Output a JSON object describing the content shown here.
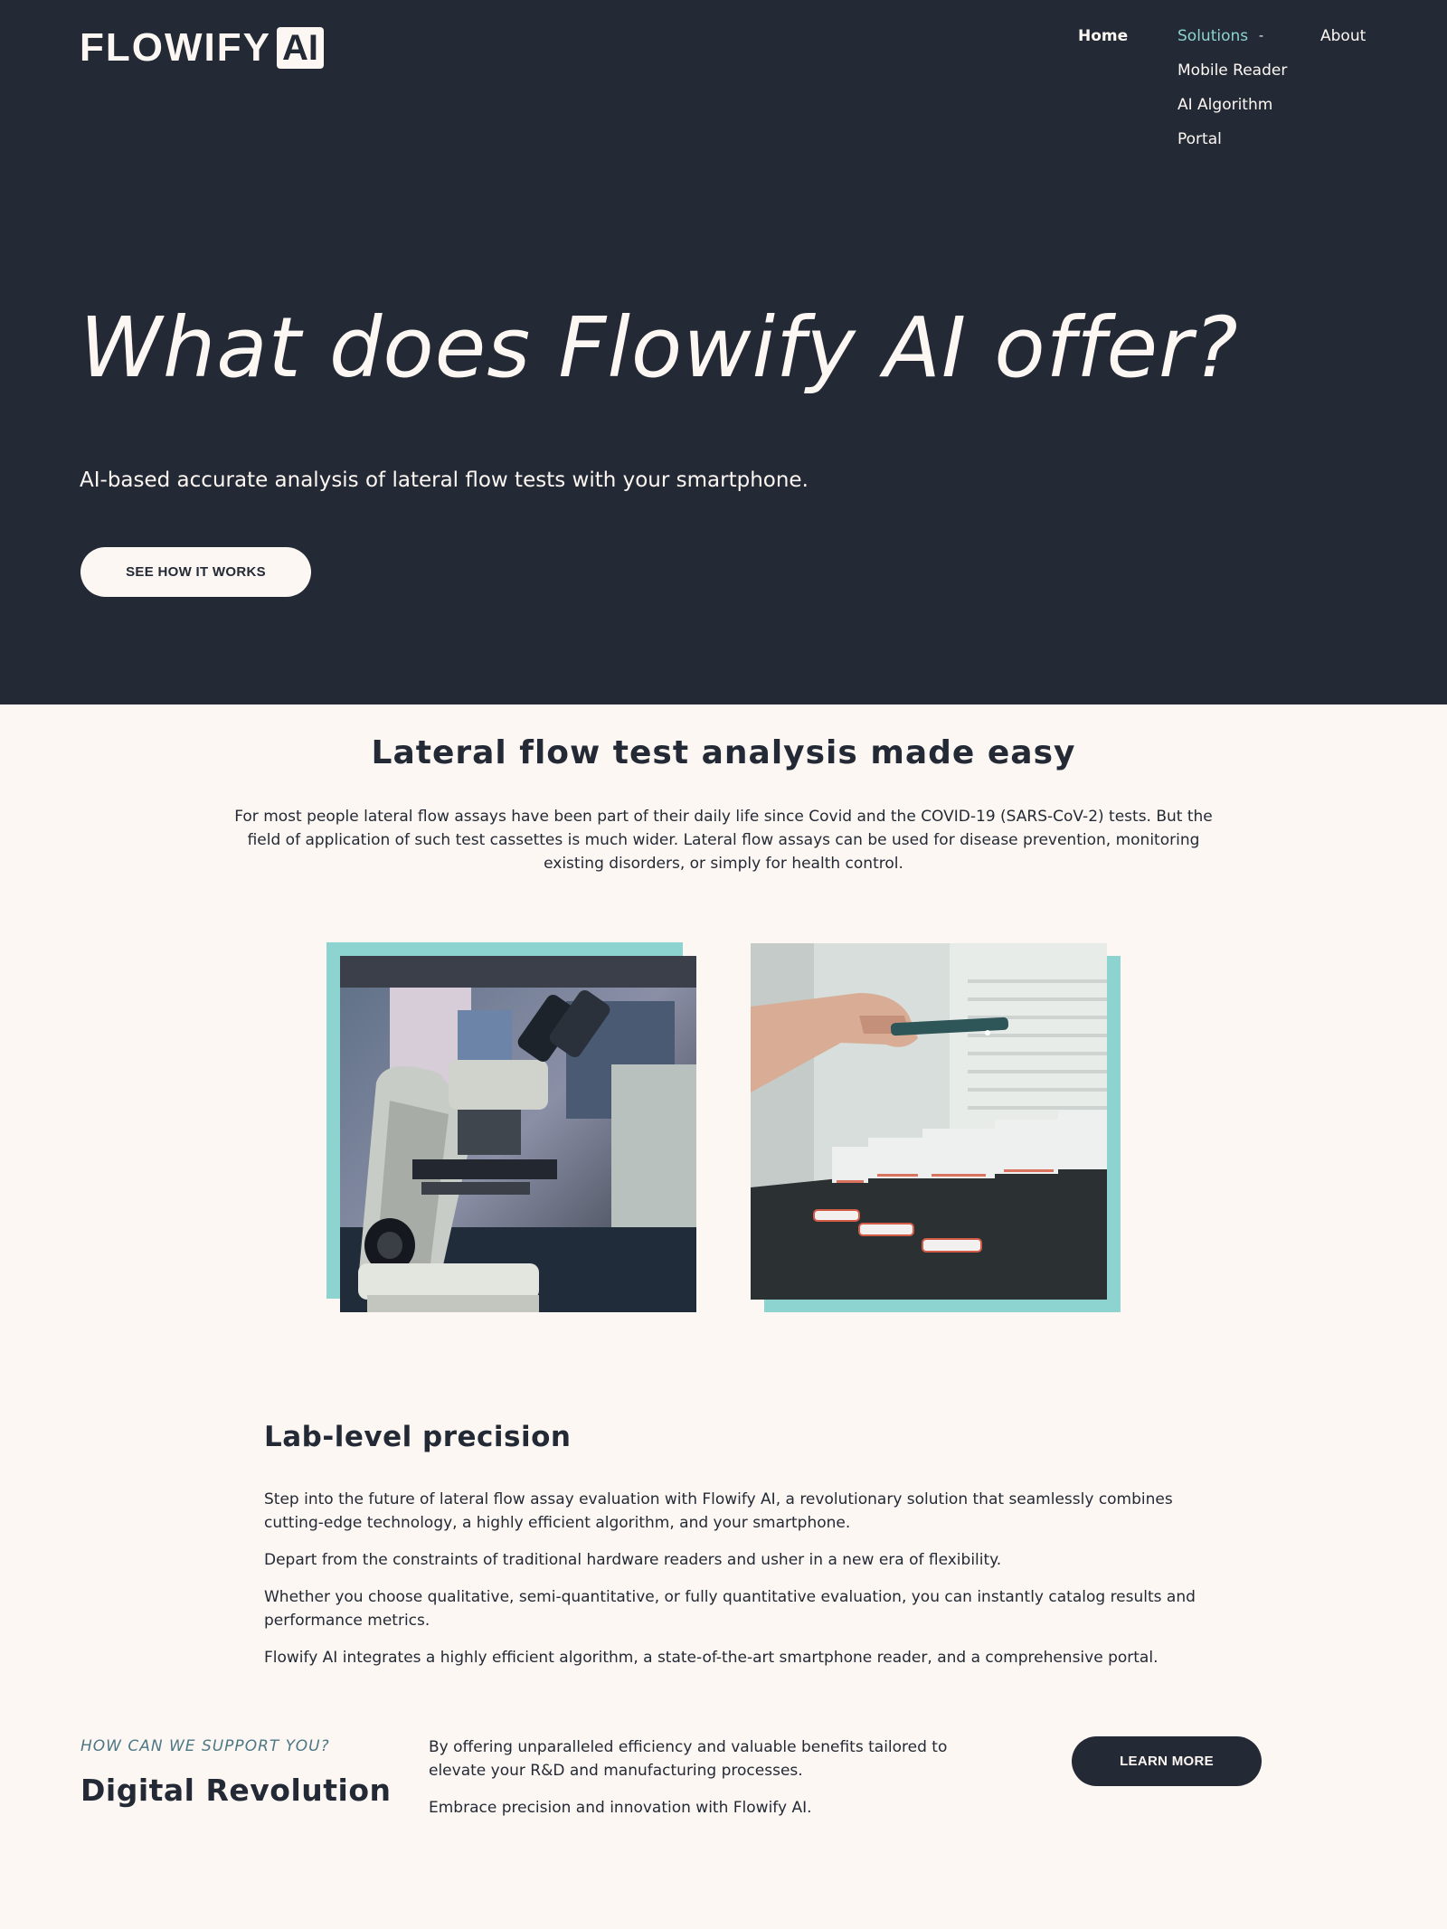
{
  "brand": {
    "name": "FLOWIFY",
    "badge": "AI"
  },
  "nav": {
    "home": "Home",
    "solutions": "Solutions",
    "solutions_chevron": "-",
    "about": "About",
    "submenu": [
      "Mobile Reader",
      "AI Algorithm",
      "Portal"
    ]
  },
  "hero": {
    "title": "What does Flowify AI offer?",
    "subtitle": "AI-based accurate analysis of lateral flow tests with your smartphone.",
    "button": "SEE HOW IT WORKS"
  },
  "section": {
    "title": "Lateral flow test analysis made easy",
    "intro": "For most people lateral flow assays have been part of their daily life since Covid and the COVID-19 (SARS-CoV-2) tests. But the field of application of such test cassettes is much wider. Lateral flow assays can be used for disease prevention, monitoring existing disorders, or simply for health control."
  },
  "precision": {
    "title": "Lab-level precision",
    "paragraphs": [
      "Step into the future of lateral flow assay evaluation with Flowify AI, a revolutionary solution that seamlessly combines cutting-edge technology, a highly efficient algorithm, and your smartphone.",
      "Depart from the constraints of traditional hardware readers and usher in a new era of flexibility.",
      "Whether you choose qualitative, semi-quantitative, or fully quantitative evaluation, you can instantly catalog results and performance metrics.",
      "Flowify AI integrates a highly efficient algorithm, a state-of-the-art smartphone reader, and a comprehensive portal."
    ]
  },
  "support": {
    "eyebrow": "HOW CAN WE SUPPORT YOU?",
    "title": "Digital Revolution",
    "text": [
      "By offering unparalleled efficiency and valuable benefits tailored to elevate your R&D and manufacturing processes.",
      "Embrace precision and innovation with Flowify AI."
    ],
    "button": "LEARN MORE"
  },
  "colors": {
    "dark": "#232a35",
    "cream": "#fdf7f3",
    "accent": "#8dd3cf",
    "eyebrow": "#4c7885"
  },
  "icons": {
    "dropdown": "chevron-down-icon"
  }
}
